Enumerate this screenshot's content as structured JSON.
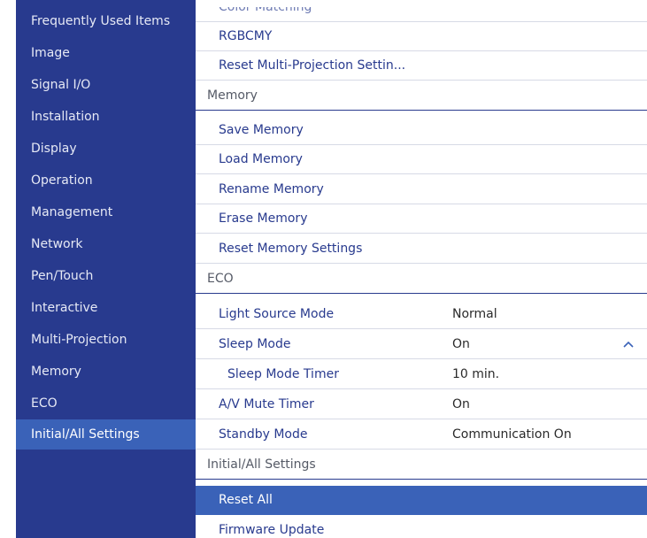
{
  "sidebar": {
    "items": [
      {
        "label": "Frequently Used Items"
      },
      {
        "label": "Image"
      },
      {
        "label": "Signal I/O"
      },
      {
        "label": "Installation"
      },
      {
        "label": "Display"
      },
      {
        "label": "Operation"
      },
      {
        "label": "Management"
      },
      {
        "label": "Network"
      },
      {
        "label": "Pen/Touch"
      },
      {
        "label": "Interactive"
      },
      {
        "label": "Multi-Projection"
      },
      {
        "label": "Memory"
      },
      {
        "label": "ECO"
      },
      {
        "label": "Initial/All Settings"
      }
    ],
    "selected_label": "Initial/All Settings"
  },
  "main": {
    "multi_projection": {
      "color_matching": "Color Matching",
      "rgbcmy": "RGBCMY",
      "reset": "Reset Multi-Projection Settin..."
    },
    "memory": {
      "header": "Memory",
      "save": "Save Memory",
      "load": "Load Memory",
      "rename": "Rename Memory",
      "erase": "Erase Memory",
      "reset": "Reset Memory Settings"
    },
    "eco": {
      "header": "ECO",
      "light_source_mode": {
        "label": "Light Source Mode",
        "value": "Normal"
      },
      "sleep_mode": {
        "label": "Sleep Mode",
        "value": "On"
      },
      "sleep_mode_timer": {
        "label": "Sleep Mode Timer",
        "value": "10 min."
      },
      "av_mute_timer": {
        "label": "A/V Mute Timer",
        "value": "On"
      },
      "standby_mode": {
        "label": "Standby Mode",
        "value": "Communication On"
      }
    },
    "initial": {
      "header": "Initial/All Settings",
      "reset_all": "Reset All",
      "firmware_update": "Firmware Update"
    }
  },
  "colors": {
    "sidebar_bg": "#283a8e",
    "selected_bg": "#3a62b8",
    "menu_text": "#283a8e"
  },
  "icons": {
    "sleep_mode_expand": "chevron-up-icon"
  }
}
